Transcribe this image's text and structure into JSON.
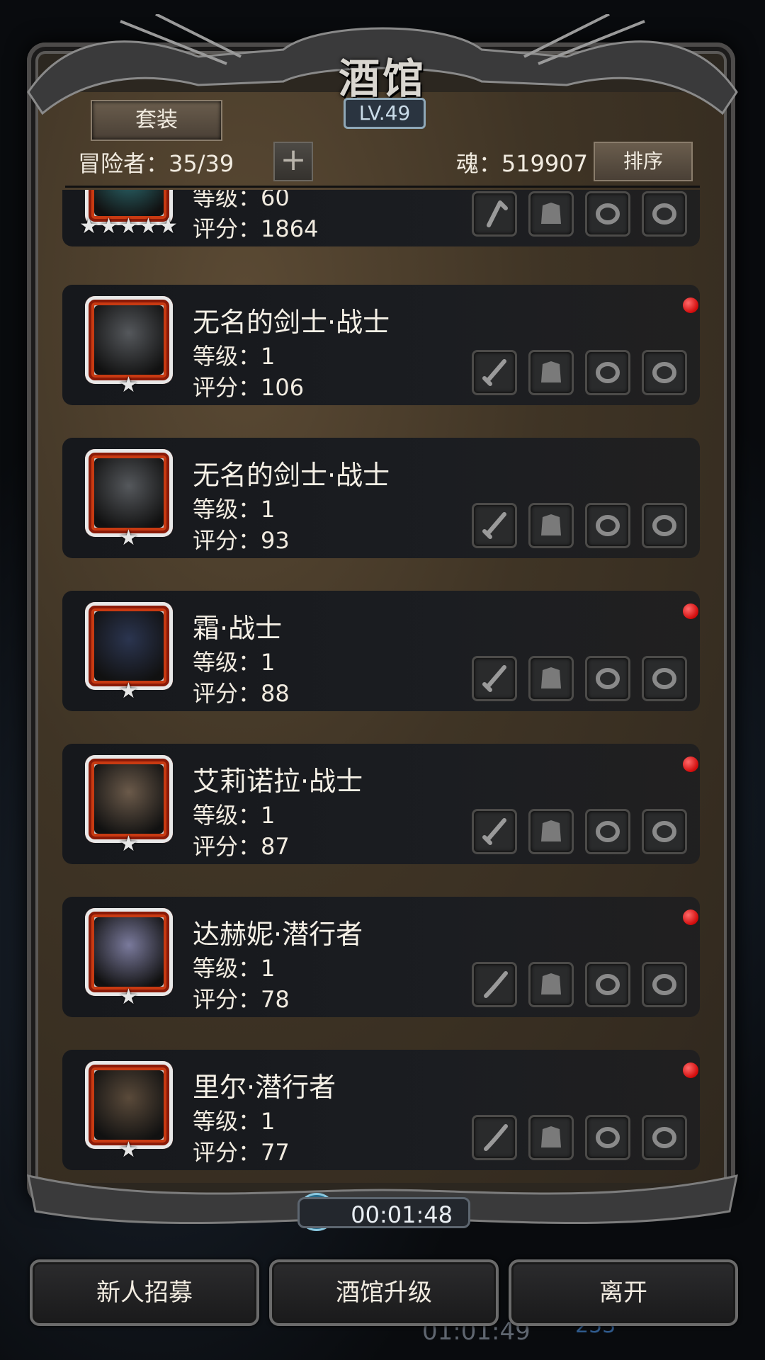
{
  "header": {
    "title": "酒馆",
    "level": "LV.49",
    "set_button": "套装",
    "adventurers_label": "冒险者：35/39",
    "soul_label": "魂：519907",
    "sort_button": "排序"
  },
  "heroes": [
    {
      "name": "",
      "level": "等级：60",
      "score": "评分：1864",
      "stars": 5,
      "new": false,
      "portrait_color": "#2d6f74",
      "weapon": "staff"
    },
    {
      "name": "无名的剑士·战士",
      "level": "等级：1",
      "score": "评分：106",
      "stars": 1,
      "new": true,
      "portrait_color": "#55585c",
      "weapon": "sword"
    },
    {
      "name": "无名的剑士·战士",
      "level": "等级：1",
      "score": "评分：93",
      "stars": 1,
      "new": false,
      "portrait_color": "#55585c",
      "weapon": "sword"
    },
    {
      "name": "霜·战士",
      "level": "等级：1",
      "score": "评分：88",
      "stars": 1,
      "new": true,
      "portrait_color": "#2b3550",
      "weapon": "sword"
    },
    {
      "name": "艾莉诺拉·战士",
      "level": "等级：1",
      "score": "评分：87",
      "stars": 1,
      "new": true,
      "portrait_color": "#6b5a4a",
      "weapon": "sword"
    },
    {
      "name": "达赫妮·潜行者",
      "level": "等级：1",
      "score": "评分：78",
      "stars": 1,
      "new": true,
      "portrait_color": "#7a7a9c",
      "weapon": "dagger"
    },
    {
      "name": "里尔·潜行者",
      "level": "等级：1",
      "score": "评分：77",
      "stars": 1,
      "new": true,
      "portrait_color": "#5a4a3a",
      "weapon": "dagger"
    }
  ],
  "timer": "00:01:48",
  "buttons": {
    "recruit": "新人招募",
    "upgrade": "酒馆升级",
    "leave": "离开"
  },
  "background": {
    "timer_text": "01:01:49",
    "number": "253"
  }
}
